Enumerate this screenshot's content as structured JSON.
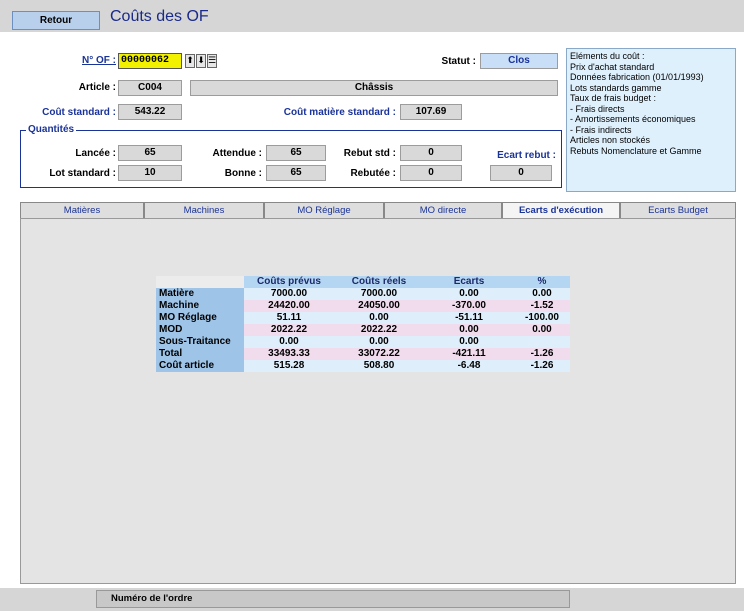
{
  "header": {
    "retour_label": "Retour",
    "title": "Coûts des OF"
  },
  "form": {
    "of_label": "N° OF :",
    "of_value": "00000062",
    "statut_label": "Statut :",
    "statut_value": "Clos",
    "article_label": "Article :",
    "article_code": "C004",
    "article_name": "Châssis",
    "cout_std_label": "Coût standard :",
    "cout_std_value": "543.22",
    "cout_mat_label": "Coût matière standard :",
    "cout_mat_value": "107.69"
  },
  "quantites": {
    "title": "Quantités",
    "lancee_label": "Lancée :",
    "lancee_value": "65",
    "attendue_label": "Attendue :",
    "attendue_value": "65",
    "rebut_std_label": "Rebut std :",
    "rebut_std_value": "0",
    "ecart_rebut_label": "Ecart rebut :",
    "ecart_rebut_value": "0",
    "lot_std_label": "Lot standard :",
    "lot_std_value": "10",
    "bonne_label": "Bonne :",
    "bonne_value": "65",
    "rebutee_label": "Rebutée :",
    "rebutee_value": "0"
  },
  "info_lines": [
    "Eléments du coût :",
    "Prix d'achat standard",
    "Données fabrication (01/01/1993)",
    "Lots standards gamme",
    "Taux de frais budget :",
    "- Frais directs",
    "- Amortissements économiques",
    "- Frais indirects",
    "Articles non stockés",
    "Rebuts Nomenclature et Gamme"
  ],
  "tabs": [
    "Matières",
    "Machines",
    "MO Réglage",
    "MO directe",
    "Ecarts d'exécution",
    "Ecarts Budget"
  ],
  "active_tab": "Ecarts d'exécution",
  "table": {
    "headers": [
      "Coûts prévus",
      "Coûts réels",
      "Ecarts",
      "%"
    ],
    "rows": [
      {
        "label": "Matière",
        "values": [
          "7000.00",
          "7000.00",
          "0.00",
          "0.00"
        ]
      },
      {
        "label": "Machine",
        "values": [
          "24420.00",
          "24050.00",
          "-370.00",
          "-1.52"
        ]
      },
      {
        "label": "MO Réglage",
        "values": [
          "51.11",
          "0.00",
          "-51.11",
          "-100.00"
        ]
      },
      {
        "label": "MOD",
        "values": [
          "2022.22",
          "2022.22",
          "0.00",
          "0.00"
        ]
      },
      {
        "label": "Sous-Traitance",
        "values": [
          "0.00",
          "0.00",
          "0.00",
          ""
        ]
      },
      {
        "label": "Total",
        "values": [
          "33493.33",
          "33072.22",
          "-421.11",
          "-1.26"
        ]
      },
      {
        "label": "Coût article",
        "values": [
          "515.28",
          "508.80",
          "-6.48",
          "-1.26"
        ]
      }
    ]
  },
  "status_text": "Numéro de l'ordre"
}
